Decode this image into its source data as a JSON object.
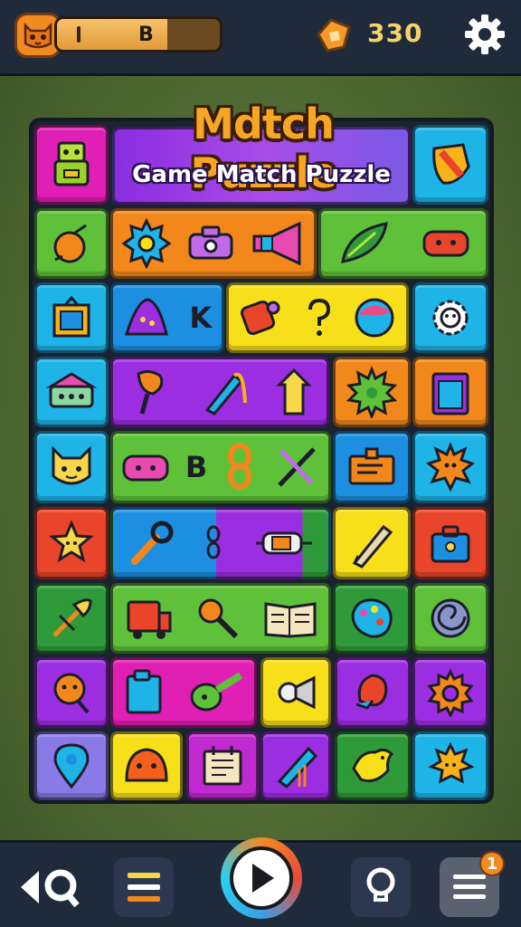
{
  "header": {
    "progress_label": "B",
    "progress_fraction": 0.68,
    "coins": "330"
  },
  "title": {
    "main": "Mdtch Puzzle",
    "sub": "Game Match Puzzle"
  },
  "board": {
    "tile_letters": [
      "K",
      "B"
    ]
  },
  "bottom_nav": {
    "notification_count": "1"
  },
  "colors": {
    "magenta": "#e01fb4",
    "purple": "#9b2ee0",
    "blue": "#1d8fe0",
    "cyan": "#1fb4e8",
    "green": "#5fc13a",
    "orange": "#f2881c",
    "yellow": "#f7e01a",
    "red": "#e8452a",
    "darkgreen": "#2f9a3a"
  },
  "icons": [
    "robot-icon",
    "shield-icon",
    "fruit-icon",
    "gear-sun-icon",
    "camera-icon",
    "megaphone-icon",
    "leaf-icon",
    "face-icon",
    "picture-frame-icon",
    "hat-icon",
    "rocket-icon",
    "question-icon",
    "globe-icon",
    "cog-icon",
    "house-icon",
    "torch-icon",
    "pen-icon",
    "castle-icon",
    "virus-icon",
    "clipboard-icon",
    "cat-icon",
    "toaster-icon",
    "chain-icon",
    "crossed-tools-icon",
    "card-icon",
    "sun-flower-icon",
    "star-icon",
    "wrench-icon",
    "ring-icon",
    "spaceship-icon",
    "pencil-icon",
    "briefcase-icon",
    "quill-icon",
    "truck-icon",
    "magnifier-icon",
    "book-icon",
    "palette-icon",
    "spiral-icon",
    "smiley-icon",
    "folder-icon",
    "guitar-icon",
    "camera-lens-icon",
    "fish-icon",
    "sun-gear-icon",
    "map-pin-icon",
    "blob-icon",
    "calendar-icon",
    "ruler-icon",
    "bird-icon",
    "crown-icon"
  ]
}
